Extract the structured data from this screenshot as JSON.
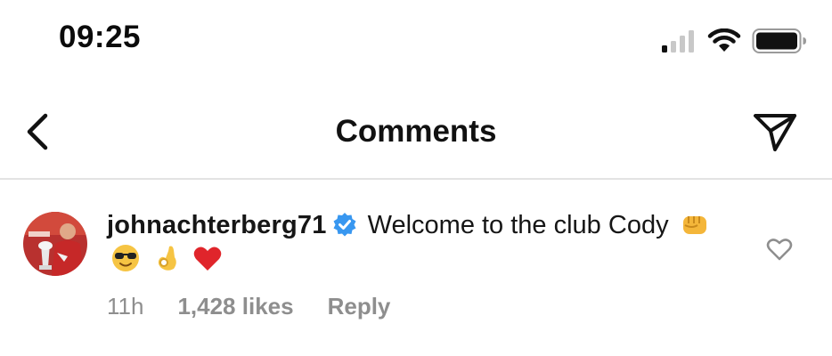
{
  "status_bar": {
    "time": "09:25",
    "signal_icon": "cellular-signal-icon",
    "wifi_icon": "wifi-icon",
    "battery_icon": "battery-icon"
  },
  "nav": {
    "back_icon": "chevron-left-icon",
    "title": "Comments",
    "share_icon": "paper-plane-icon"
  },
  "comment": {
    "username": "johnachterberg71",
    "verified_icon": "verified-badge-icon",
    "text": "Welcome to the club Cody",
    "emojis": [
      "fist-bump-emoji",
      "sunglasses-emoji",
      "ok-hand-emoji",
      "red-heart-emoji"
    ],
    "time_ago": "11h",
    "likes": "1,428 likes",
    "reply_label": "Reply",
    "like_icon": "heart-outline-icon"
  },
  "colors": {
    "verified_blue": "#3897f0",
    "meta_gray": "#8e8e8e",
    "divider": "#e3e3e3",
    "heart_red": "#e0252b"
  }
}
